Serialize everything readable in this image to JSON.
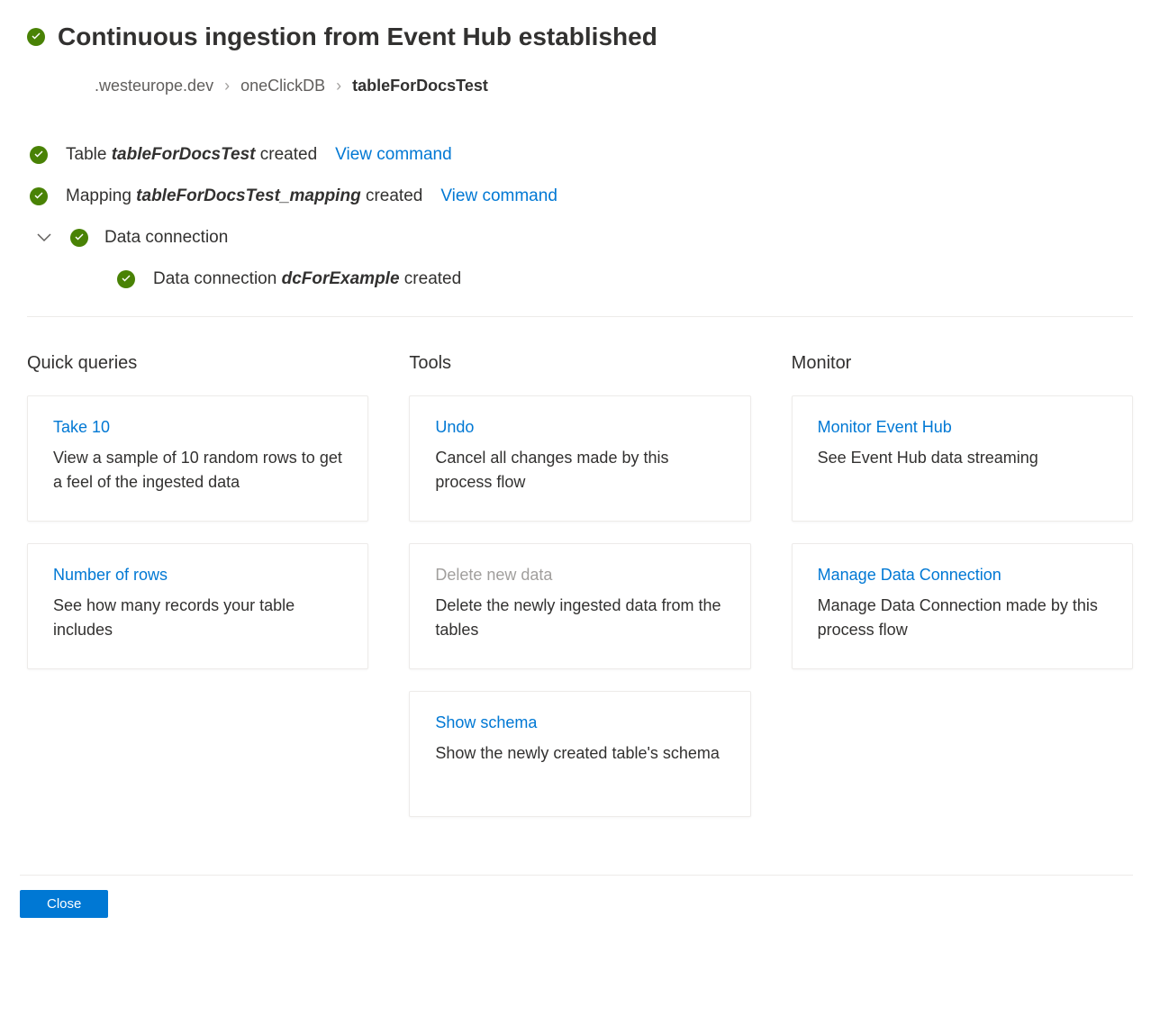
{
  "header": {
    "title": "Continuous ingestion from Event Hub established"
  },
  "breadcrumb": {
    "cluster": ".westeurope.dev",
    "database": "oneClickDB",
    "table": "tableForDocsTest"
  },
  "status": {
    "table": {
      "prefix": "Table ",
      "name": "tableForDocsTest",
      "suffix": " created",
      "view_command": "View command"
    },
    "mapping": {
      "prefix": "Mapping ",
      "name": "tableForDocsTest_mapping",
      "suffix": " created",
      "view_command": "View command"
    },
    "data_connection": {
      "label": "Data connection",
      "sub": {
        "prefix": "Data connection ",
        "name": "dcForExample",
        "suffix": " created"
      }
    }
  },
  "columns": {
    "quick_queries": {
      "title": "Quick queries",
      "cards": [
        {
          "title": "Take 10",
          "desc": "View a sample of 10 random rows to get a feel of the ingested data",
          "disabled": false
        },
        {
          "title": "Number of rows",
          "desc": "See how many records your table includes",
          "disabled": false
        }
      ]
    },
    "tools": {
      "title": "Tools",
      "cards": [
        {
          "title": "Undo",
          "desc": "Cancel all changes made by this process flow",
          "disabled": false
        },
        {
          "title": "Delete new data",
          "desc": "Delete the newly ingested data from the tables",
          "disabled": true
        },
        {
          "title": "Show schema",
          "desc": "Show the newly created table's schema",
          "disabled": false
        }
      ]
    },
    "monitor": {
      "title": "Monitor",
      "cards": [
        {
          "title": "Monitor Event Hub",
          "desc": "See Event Hub data streaming",
          "disabled": false
        },
        {
          "title": "Manage Data Connection",
          "desc": "Manage Data Connection made by this process flow",
          "disabled": false
        }
      ]
    }
  },
  "footer": {
    "close_label": "Close"
  }
}
